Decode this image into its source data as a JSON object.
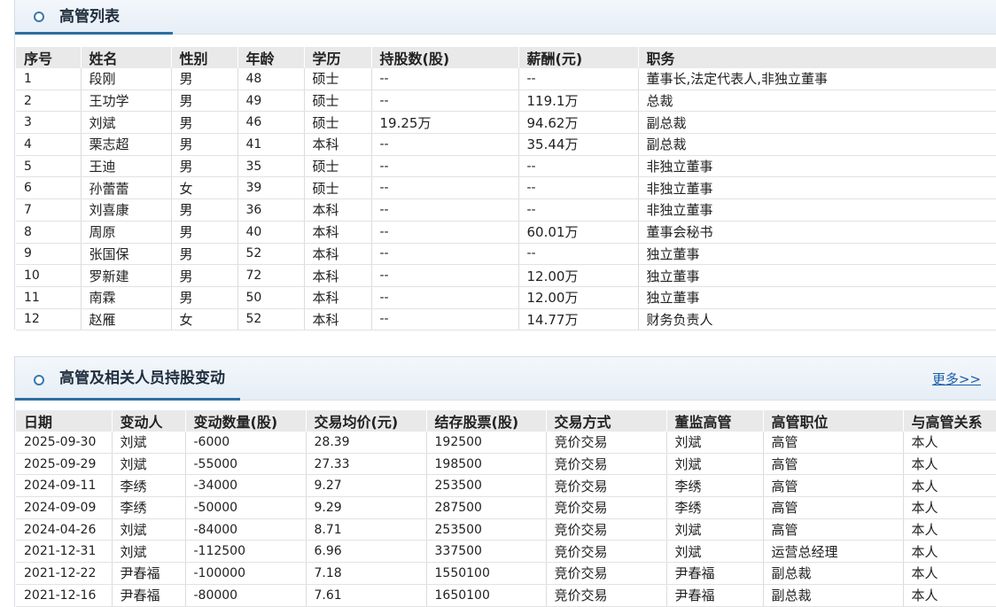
{
  "executives": {
    "title": "高管列表",
    "columns": [
      "序号",
      "姓名",
      "性别",
      "年龄",
      "学历",
      "持股数(股)",
      "薪酬(元)",
      "职务"
    ],
    "rows": [
      [
        "1",
        "段刚",
        "男",
        "48",
        "硕士",
        "--",
        "--",
        "董事长,法定代表人,非独立董事"
      ],
      [
        "2",
        "王功学",
        "男",
        "49",
        "硕士",
        "--",
        "119.1万",
        "总裁"
      ],
      [
        "3",
        "刘斌",
        "男",
        "46",
        "硕士",
        "19.25万",
        "94.62万",
        "副总裁"
      ],
      [
        "4",
        "栗志超",
        "男",
        "41",
        "本科",
        "--",
        "35.44万",
        "副总裁"
      ],
      [
        "5",
        "王迪",
        "男",
        "35",
        "硕士",
        "--",
        "--",
        "非独立董事"
      ],
      [
        "6",
        "孙蕾蕾",
        "女",
        "39",
        "硕士",
        "--",
        "--",
        "非独立董事"
      ],
      [
        "7",
        "刘喜康",
        "男",
        "36",
        "本科",
        "--",
        "--",
        "非独立董事"
      ],
      [
        "8",
        "周原",
        "男",
        "40",
        "本科",
        "--",
        "60.01万",
        "董事会秘书"
      ],
      [
        "9",
        "张国保",
        "男",
        "52",
        "本科",
        "--",
        "--",
        "独立董事"
      ],
      [
        "10",
        "罗新建",
        "男",
        "72",
        "本科",
        "--",
        "12.00万",
        "独立董事"
      ],
      [
        "11",
        "南霖",
        "男",
        "50",
        "本科",
        "--",
        "12.00万",
        "独立董事"
      ],
      [
        "12",
        "赵雁",
        "女",
        "52",
        "本科",
        "--",
        "14.77万",
        "财务负责人"
      ]
    ]
  },
  "holdings": {
    "title": "高管及相关人员持股变动",
    "more_link": "更多>>",
    "columns": [
      "日期",
      "变动人",
      "变动数量(股)",
      "交易均价(元)",
      "结存股票(股)",
      "交易方式",
      "董监高管",
      "高管职位",
      "与高管关系"
    ],
    "rows": [
      [
        "2025-09-30",
        "刘斌",
        "-6000",
        "28.39",
        "192500",
        "竞价交易",
        "刘斌",
        "高管",
        "本人"
      ],
      [
        "2025-09-29",
        "刘斌",
        "-55000",
        "27.33",
        "198500",
        "竞价交易",
        "刘斌",
        "高管",
        "本人"
      ],
      [
        "2024-09-11",
        "李绣",
        "-34000",
        "9.27",
        "253500",
        "竞价交易",
        "李绣",
        "高管",
        "本人"
      ],
      [
        "2024-09-09",
        "李绣",
        "-50000",
        "9.29",
        "287500",
        "竞价交易",
        "李绣",
        "高管",
        "本人"
      ],
      [
        "2024-04-26",
        "刘斌",
        "-84000",
        "8.71",
        "253500",
        "竞价交易",
        "刘斌",
        "高管",
        "本人"
      ],
      [
        "2021-12-31",
        "刘斌",
        "-112500",
        "6.96",
        "337500",
        "竞价交易",
        "刘斌",
        "运营总经理",
        "本人"
      ],
      [
        "2021-12-22",
        "尹春福",
        "-100000",
        "7.18",
        "1550100",
        "竞价交易",
        "尹春福",
        "副总裁",
        "本人"
      ],
      [
        "2021-12-16",
        "尹春福",
        "-80000",
        "7.61",
        "1650100",
        "竞价交易",
        "尹春福",
        "副总裁",
        "本人"
      ]
    ]
  },
  "colors": {
    "accent": "#2f6e9f",
    "header_bg": "#e9e9e9",
    "link": "#1a5fa8"
  },
  "icons": {
    "section_bullet": "circle-bullet-icon"
  }
}
